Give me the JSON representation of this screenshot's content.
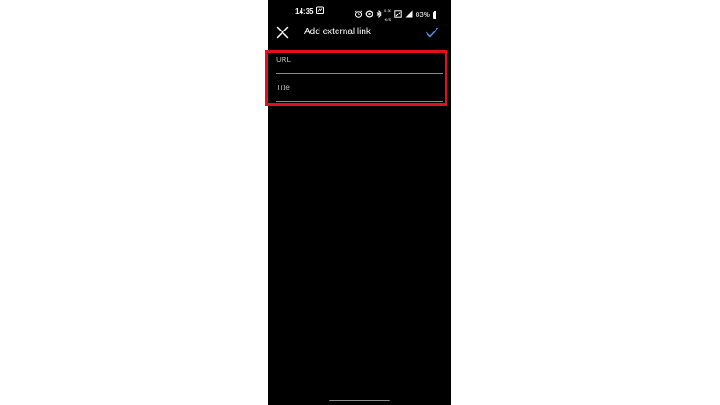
{
  "status_bar": {
    "time": "14:35",
    "net_speed_top": "0.30",
    "net_speed_bottom": "K/S",
    "battery": "83%"
  },
  "app_bar": {
    "title": "Add external link",
    "close_icon": "close-icon",
    "confirm_icon": "check-icon"
  },
  "form": {
    "url_placeholder": "URL",
    "url_value": "",
    "title_placeholder": "Title",
    "title_value": ""
  },
  "colors": {
    "background": "#000000",
    "accent": "#4a90e2",
    "highlight": "#e3101b",
    "underline": "#8a8a8a"
  }
}
